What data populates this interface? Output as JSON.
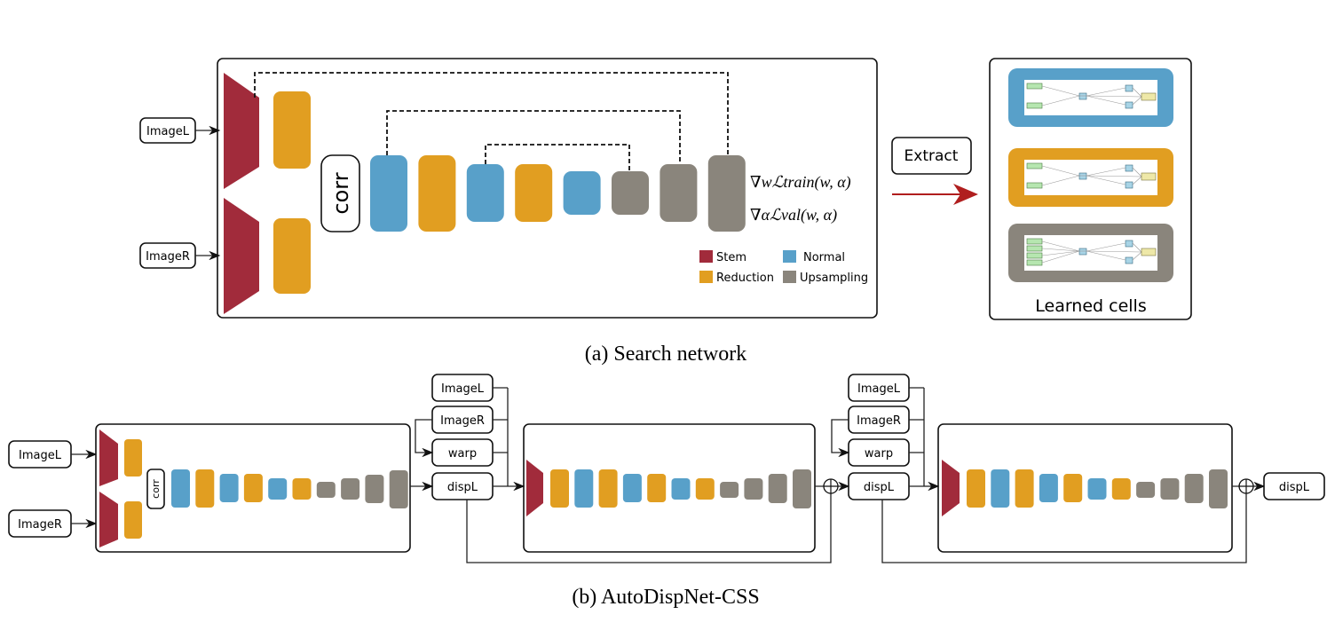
{
  "colors": {
    "stem": "#A12B3B",
    "reduction": "#E19E21",
    "normal": "#58A0C9",
    "upsampling": "#8A857C",
    "extract_arrow": "#B01E1E"
  },
  "search": {
    "inputs": [
      "ImageL",
      "ImageR"
    ],
    "corr": "corr",
    "formula_train": "∇wℒtrain(w, α)",
    "formula_val": "∇αℒval(w, α)",
    "cells": [
      "normal",
      "reduction",
      "normal",
      "reduction",
      "normal",
      "upsampling",
      "upsampling",
      "upsampling"
    ],
    "legend": [
      {
        "label": "Stem",
        "type": "stem"
      },
      {
        "label": "Normal",
        "type": "normal"
      },
      {
        "label": "Reduction",
        "type": "reduction"
      },
      {
        "label": "Upsampling",
        "type": "upsampling"
      }
    ],
    "caption": "(a) Search network"
  },
  "extract": {
    "label": "Extract"
  },
  "learned": {
    "title": "Learned cells",
    "cell_types": [
      "normal",
      "reduction",
      "upsampling"
    ]
  },
  "css": {
    "inputs": [
      "ImageL",
      "ImageR"
    ],
    "corr": "corr",
    "net1_cells": [
      "normal",
      "reduction",
      "normal",
      "reduction",
      "normal",
      "reduction",
      "upsampling",
      "upsampling",
      "upsampling",
      "upsampling"
    ],
    "net_cells": [
      "reduction",
      "normal",
      "reduction",
      "normal",
      "reduction",
      "normal",
      "reduction",
      "upsampling",
      "upsampling",
      "upsampling",
      "upsampling"
    ],
    "stage_inputs": [
      "ImageL",
      "ImageR",
      "warp",
      "dispL"
    ],
    "output": "dispL",
    "caption": "(b) AutoDispNet-CSS"
  }
}
